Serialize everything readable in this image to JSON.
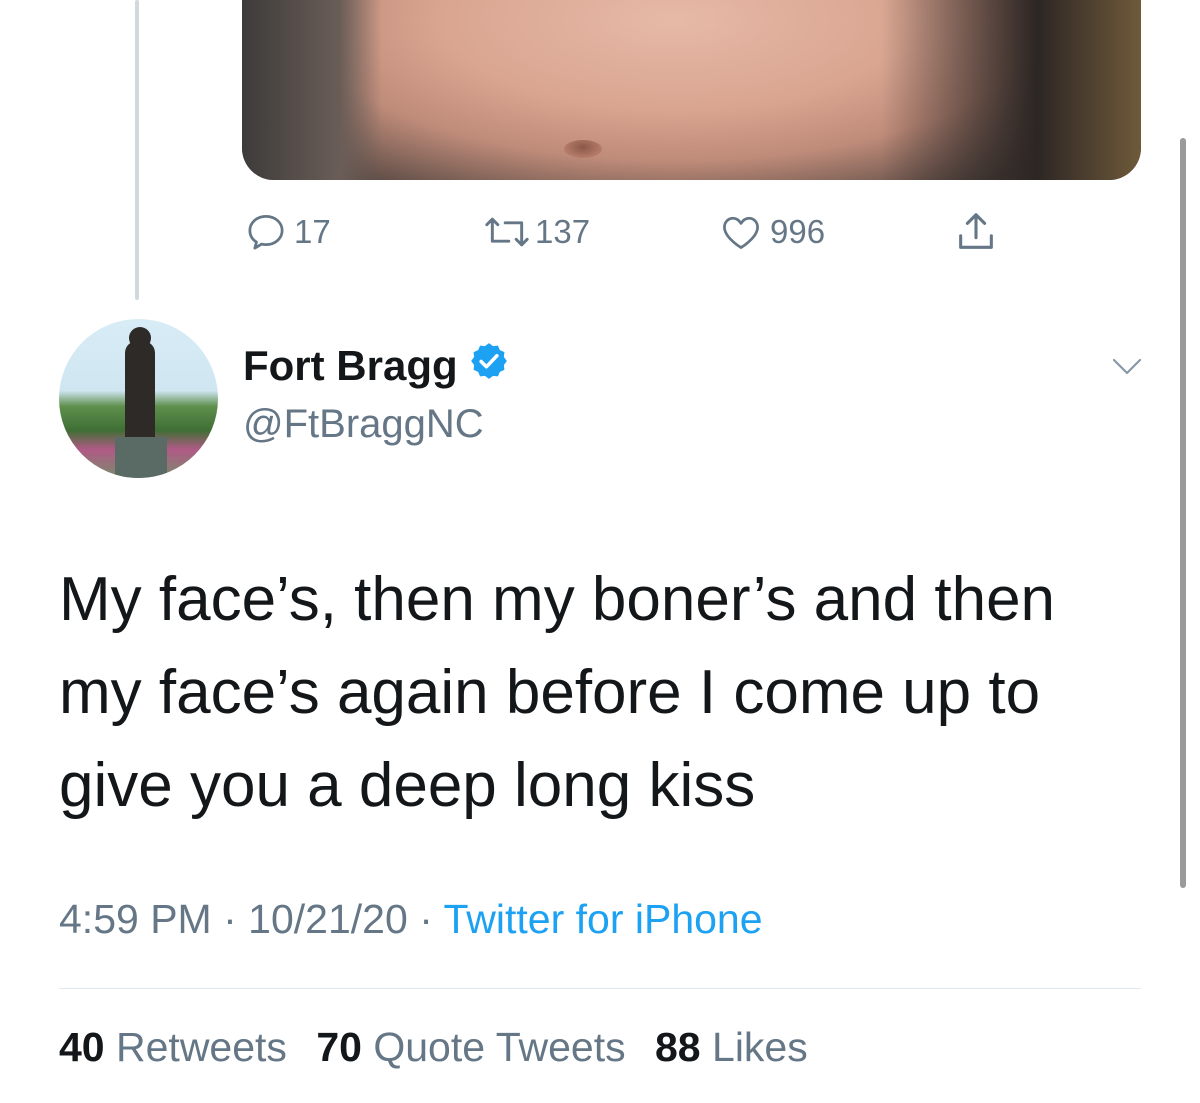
{
  "parent_tweet": {
    "actions": {
      "reply_count": "17",
      "retweet_count": "137",
      "like_count": "996"
    }
  },
  "tweet": {
    "author_name": "Fort Bragg",
    "author_handle": "@FtBraggNC",
    "verified": true,
    "text": "My face’s, then my boner’s and then my face’s again before I come up to give you a deep long kiss",
    "time": "4:59 PM",
    "separator": "·",
    "date": "10/21/20",
    "source": "Twitter for iPhone",
    "stats": {
      "retweets_count": "40",
      "retweets_label": "Retweets",
      "quote_count": "70",
      "quote_label": "Quote Tweets",
      "likes_count": "88",
      "likes_label": "Likes"
    }
  },
  "colors": {
    "text_primary": "#14171a",
    "text_secondary": "#657786",
    "link": "#1da1f2",
    "verified": "#1da1f2"
  },
  "icons": [
    "reply-icon",
    "retweet-icon",
    "like-icon",
    "share-icon",
    "verified-badge-icon",
    "chevron-down-icon"
  ]
}
